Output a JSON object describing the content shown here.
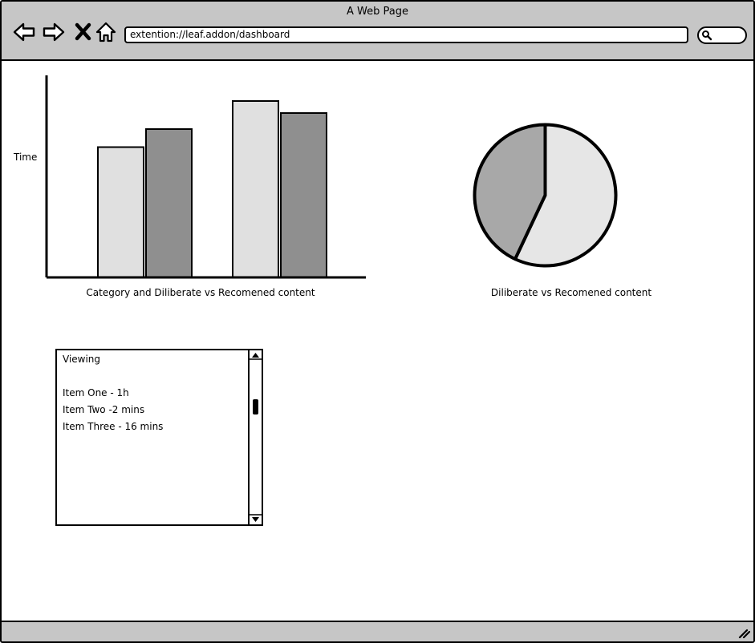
{
  "window": {
    "title": "A Web Page",
    "url": "extention://leaf.addon/dashboard"
  },
  "icons": {
    "back": "arrow-left-icon",
    "forward": "arrow-right-icon",
    "stop": "close-icon",
    "home": "home-icon",
    "search": "search-icon",
    "resize": "resize-grip-icon"
  },
  "colors": {
    "chrome": "#c6c6c6",
    "light_series": "#e0e0e0",
    "dark_series": "#8f8f8f",
    "pie_light": "#e6e6e6",
    "pie_dark": "#a8a8a8"
  },
  "chart_data": [
    {
      "type": "bar",
      "title": "",
      "xlabel": "Category and Diliberate vs Recomened content",
      "ylabel": "Time",
      "ylim": [
        0,
        100
      ],
      "grid": false,
      "legend": "none",
      "categories": [
        "",
        ""
      ],
      "series": [
        {
          "values": [
            65,
            88
          ],
          "color": "#e0e0e0"
        },
        {
          "values": [
            74,
            82
          ],
          "color": "#8f8f8f"
        }
      ]
    },
    {
      "type": "pie",
      "title": "",
      "xlabel": "Diliberate vs Recomened content",
      "slices": [
        {
          "value": 57,
          "color": "#e6e6e6"
        },
        {
          "value": 43,
          "color": "#a8a8a8"
        }
      ]
    }
  ],
  "viewing": {
    "header": "Viewing",
    "items": [
      "Item One - 1h",
      "Item Two -2 mins",
      "Item Three - 16 mins"
    ]
  }
}
